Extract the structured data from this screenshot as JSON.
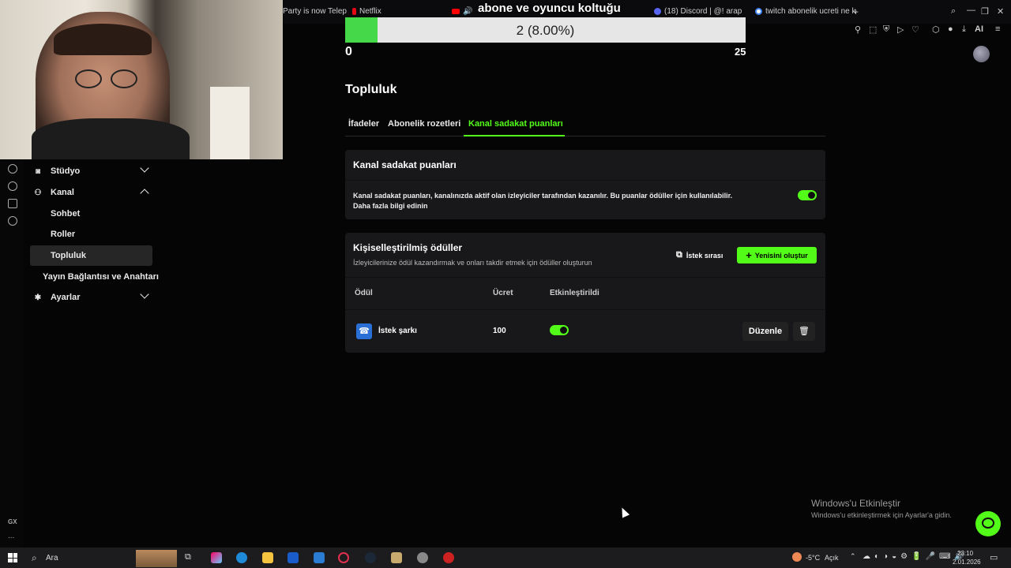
{
  "browser": {
    "tabs": [
      {
        "label": "Party is now Telep"
      },
      {
        "label": "Netflix"
      },
      {
        "label": "(18) Discord | @! arap"
      },
      {
        "label": "twitch abonelik ucreti ne k"
      }
    ],
    "new_tab": "+",
    "ai_label": "AI"
  },
  "overlay": {
    "title": "abone ve oyuncu koltuğu"
  },
  "goal": {
    "text": "2 (8.00%)",
    "min": "0",
    "max": "25",
    "progress": 0.08
  },
  "nav": {
    "items": [
      {
        "label": "Stüdyo"
      },
      {
        "label": "Kanal"
      },
      {
        "label": "Sohbet"
      },
      {
        "label": "Roller"
      },
      {
        "label": "Topluluk"
      },
      {
        "label": "Yayın Bağlantısı ve Anahtarı"
      },
      {
        "label": "Ayarlar"
      }
    ]
  },
  "main": {
    "title": "Topluluk",
    "tabs": [
      {
        "label": "İfadeler"
      },
      {
        "label": "Abonelik rozetleri"
      },
      {
        "label": "Kanal sadakat puanları"
      }
    ],
    "loyalty": {
      "title": "Kanal sadakat puanları",
      "description": "Kanal sadakat puanları, kanalınızda aktif olan izleyiciler tarafından kazanılır. Bu puanlar ödüller için kullanılabilir.",
      "link": "Daha fazla bilgi edinin",
      "enabled": true
    },
    "rewards": {
      "title": "Kişiselleştirilmiş ödüller",
      "subtitle": "İzleyicilerinize ödül kazandırmak ve onları takdir etmek için ödüller oluşturun",
      "queue_button": "İstek sırası",
      "create_button": "Yenisini oluştur",
      "columns": [
        "Ödül",
        "Ücret",
        "Etkinleştirildi"
      ],
      "rows": [
        {
          "name": "İstek şarkı",
          "cost": "100",
          "enabled": true,
          "edit_label": "Düzenle"
        }
      ]
    }
  },
  "windows": {
    "activate_title": "Windows'u Etkinleştir",
    "activate_sub": "Windows'u etkinleştirmek için Ayarlar'a gidin."
  },
  "taskbar": {
    "search": "Ara",
    "temp": "-5°C",
    "weather": "Açık",
    "time": "23:10",
    "date": "2.01.2026"
  },
  "gx": {
    "label": "GX",
    "more": "..."
  },
  "colors": {
    "accent": "#53fc18",
    "goal_fill": "#45d94a",
    "card": "#18181a"
  }
}
